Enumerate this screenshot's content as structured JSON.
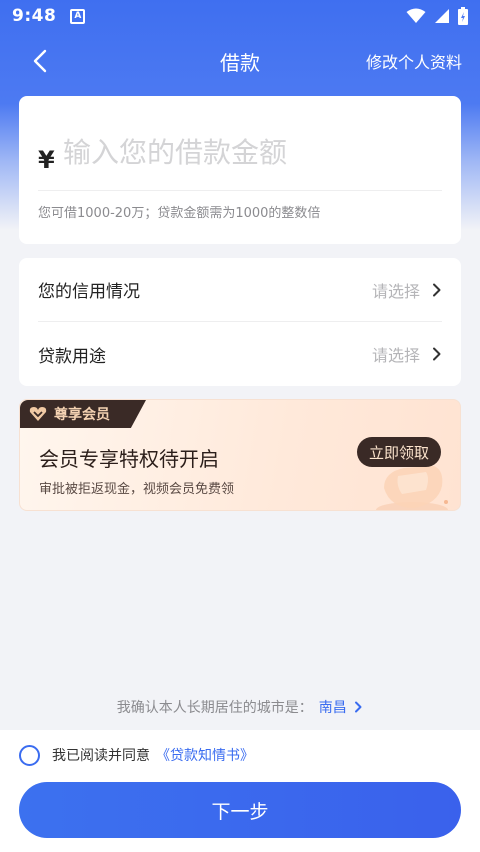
{
  "status_bar": {
    "time": "9:48",
    "a_icon_text": "A"
  },
  "nav": {
    "title": "借款",
    "edit_profile": "修改个人资料"
  },
  "amount": {
    "currency_symbol": "¥",
    "placeholder": "输入您的借款金额",
    "value": "",
    "hint": "您可借1000-20万；贷款金额需为1000的整数倍"
  },
  "selects": [
    {
      "label": "您的信用情况",
      "value": "请选择"
    },
    {
      "label": "贷款用途",
      "value": "请选择"
    }
  ],
  "vip": {
    "tag": "尊享会员",
    "title": "会员专享特权待开启",
    "subtitle": "审批被拒返现金，视频会员免费领",
    "button": "立即领取"
  },
  "city": {
    "prefix": "我确认本人长期居住的城市是：",
    "name": "南昌"
  },
  "agreement": {
    "text": "我已阅读并同意",
    "link": "《贷款知情书》",
    "checked": false
  },
  "next_button": "下一步",
  "colors": {
    "primary": "#3a6cf0",
    "vip_dark": "#3a2a26",
    "hint_gray": "#8b8b8f"
  }
}
